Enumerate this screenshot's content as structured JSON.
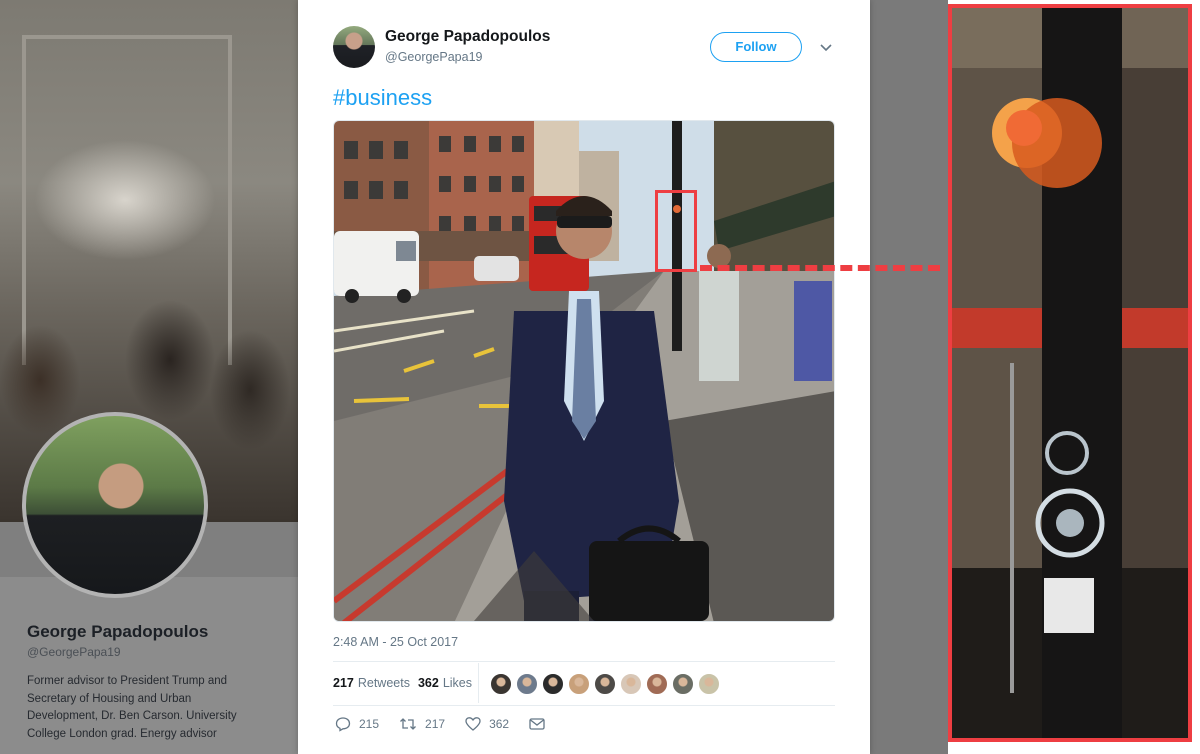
{
  "profile": {
    "name": "George Papadopoulos",
    "handle": "@GeorgePapa19",
    "bio": "Former advisor to President Trump and Secretary of Housing and Urban Development, Dr. Ben Carson. University College London grad. Energy advisor"
  },
  "tweet": {
    "author_name": "George Papadopoulos",
    "author_handle": "@GeorgePapa19",
    "follow_label": "Follow",
    "text": "#business",
    "timestamp": "2:48 AM - 25 Oct 2017",
    "retweets_count": "217",
    "retweets_label": "Retweets",
    "likes_count": "362",
    "likes_label": "Likes",
    "reply_count": "215",
    "retweet_action_count": "217",
    "like_action_count": "362",
    "liker_avatar_colors": [
      "#3a3531",
      "#6d7a8c",
      "#2b2b2b",
      "#c8a07a",
      "#4d4a47",
      "#d8c7b7",
      "#a06b55",
      "#6a6d64",
      "#c9c3a8"
    ]
  },
  "icons": {
    "caret": "chevron-down-icon",
    "reply": "reply-icon",
    "retweet": "retweet-icon",
    "like": "heart-icon",
    "dm": "envelope-icon"
  },
  "colors": {
    "accent": "#1da1f2",
    "highlight": "#ee3e42"
  }
}
